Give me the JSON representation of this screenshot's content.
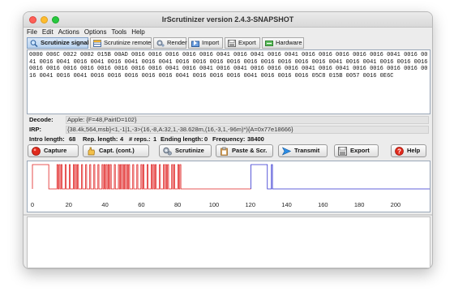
{
  "window": {
    "title": "IrScrutinizer version 2.4.3-SNAPSHOT"
  },
  "menu": [
    "File",
    "Edit",
    "Actions",
    "Options",
    "Tools",
    "Help"
  ],
  "tabs": [
    {
      "label": "Scrutinize signal",
      "icon": "magnifier-icon"
    },
    {
      "label": "Scrutinize remote",
      "icon": "remote-table-icon"
    },
    {
      "label": "Render",
      "icon": "render-gear-icon"
    },
    {
      "label": "Import",
      "icon": "import-icon"
    },
    {
      "label": "Export",
      "icon": "export-disk-icon"
    },
    {
      "label": "Hardware",
      "icon": "hardware-icon"
    }
  ],
  "signal_text": "0000 006C 0022 0002 015B 00AD 0016 0016 0016 0016 0016 0041 0016 0041 0016 0041 0016 0016 0016 0016 0016 0041 0016 0041 0016 0041 0016 0041 0016 0041 0016 0041 0016 0016 0016 0016 0016 0016 0016 0016 0016 0041 0016 0041 0016 0016 0016 0016 0016 0016 0016 0016 0016 0016 0016 0041 0016 0041 0016 0041 0016 0016 0016 0041 0016 0041 0016 0016 0016 0016 0016 0041 0016 0041 0016 0016 0016 0016 0016 0041 0016 0016 0016 0041 0016 0016 0016 05C8 015B 0057 0016 0E6C",
  "decode": {
    "label": "Decode:",
    "value": "Apple: {F=48,PairID=102}"
  },
  "irp": {
    "label": "IRP:",
    "value": "{38.4k,564,msb}<1,-1|1,-3>(16,-8,A:32,1,-38.628m,(16,-3,1,-96m)*){A=0x77e18666}"
  },
  "stats": {
    "intro_label": "Intro length:",
    "intro_value": "68",
    "rep_label": "Rep. length:",
    "rep_value": "4",
    "reps_label": "# reps.:",
    "reps_value": "1",
    "ending_label": "Ending length:",
    "ending_value": "0",
    "freq_label": "Frequency:",
    "freq_value": "38400"
  },
  "buttons": [
    {
      "label": "Capture",
      "icon": "record-red-icon"
    },
    {
      "label": "Capt. (cont.)",
      "icon": "hand-icon"
    },
    {
      "label": "Scrutinize",
      "icon": "gears-icon"
    },
    {
      "label": "Paste & Scr.",
      "icon": "paste-icon"
    },
    {
      "label": "Transmit",
      "icon": "transmit-arrow-icon"
    },
    {
      "label": "Export",
      "icon": "export-disk-icon"
    },
    {
      "label": "Help",
      "icon": "help-icon"
    }
  ],
  "colors": {
    "intro": "#e02020",
    "repeat": "#3030d0",
    "active_tab": "#b8d2ee"
  },
  "chart_data": {
    "type": "line",
    "x_ticks": [
      0,
      20,
      40,
      60,
      80,
      100,
      120,
      140,
      160,
      180,
      200
    ],
    "xlim": [
      0,
      217
    ],
    "unit": "ms",
    "intro_durations_us": [
      9000,
      4500,
      564,
      564,
      564,
      564,
      564,
      1692,
      564,
      1692,
      564,
      1692,
      564,
      564,
      564,
      564,
      564,
      1692,
      564,
      1692,
      564,
      1692,
      564,
      1692,
      564,
      1692,
      564,
      1692,
      564,
      564,
      564,
      564,
      564,
      564,
      564,
      564,
      564,
      1692,
      564,
      1692,
      564,
      564,
      564,
      564,
      564,
      564,
      564,
      564,
      564,
      564,
      564,
      1692,
      564,
      1692,
      564,
      1692,
      564,
      564,
      564,
      1692,
      564,
      1692,
      564,
      564,
      564,
      564,
      564,
      1692,
      564,
      1692,
      564,
      564,
      564,
      564,
      564,
      1692,
      564,
      564,
      564,
      1692,
      564,
      564,
      564,
      38628
    ],
    "repeat_durations_us": [
      9000,
      2250,
      564,
      96000
    ]
  }
}
